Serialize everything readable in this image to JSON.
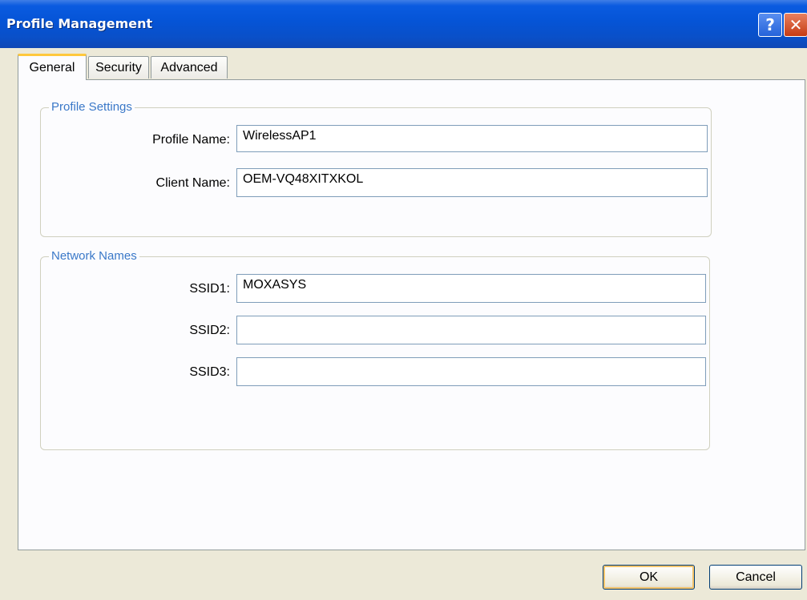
{
  "window": {
    "title": "Profile Management"
  },
  "titlebar": {
    "help_label": "?",
    "close_label": "✕"
  },
  "tabs": [
    {
      "label": "General",
      "active": true
    },
    {
      "label": "Security",
      "active": false
    },
    {
      "label": "Advanced",
      "active": false
    }
  ],
  "profile_settings": {
    "legend": "Profile Settings",
    "profile_name_label": "Profile Name:",
    "profile_name_value": "WirelessAP1",
    "client_name_label": "Client Name:",
    "client_name_value": "OEM-VQ48XITXKOL"
  },
  "network_names": {
    "legend": "Network Names",
    "ssid1_label": "SSID1:",
    "ssid1_value": "MOXASYS",
    "ssid2_label": "SSID2:",
    "ssid2_value": "",
    "ssid3_label": "SSID3:",
    "ssid3_value": ""
  },
  "buttons": {
    "ok_label": "OK",
    "cancel_label": "Cancel"
  },
  "colors": {
    "titlebar": "#0554d6",
    "legend_text": "#3a78c8",
    "active_tab_accent": "#ffc83c",
    "dialog_bg": "#ece9d8"
  }
}
